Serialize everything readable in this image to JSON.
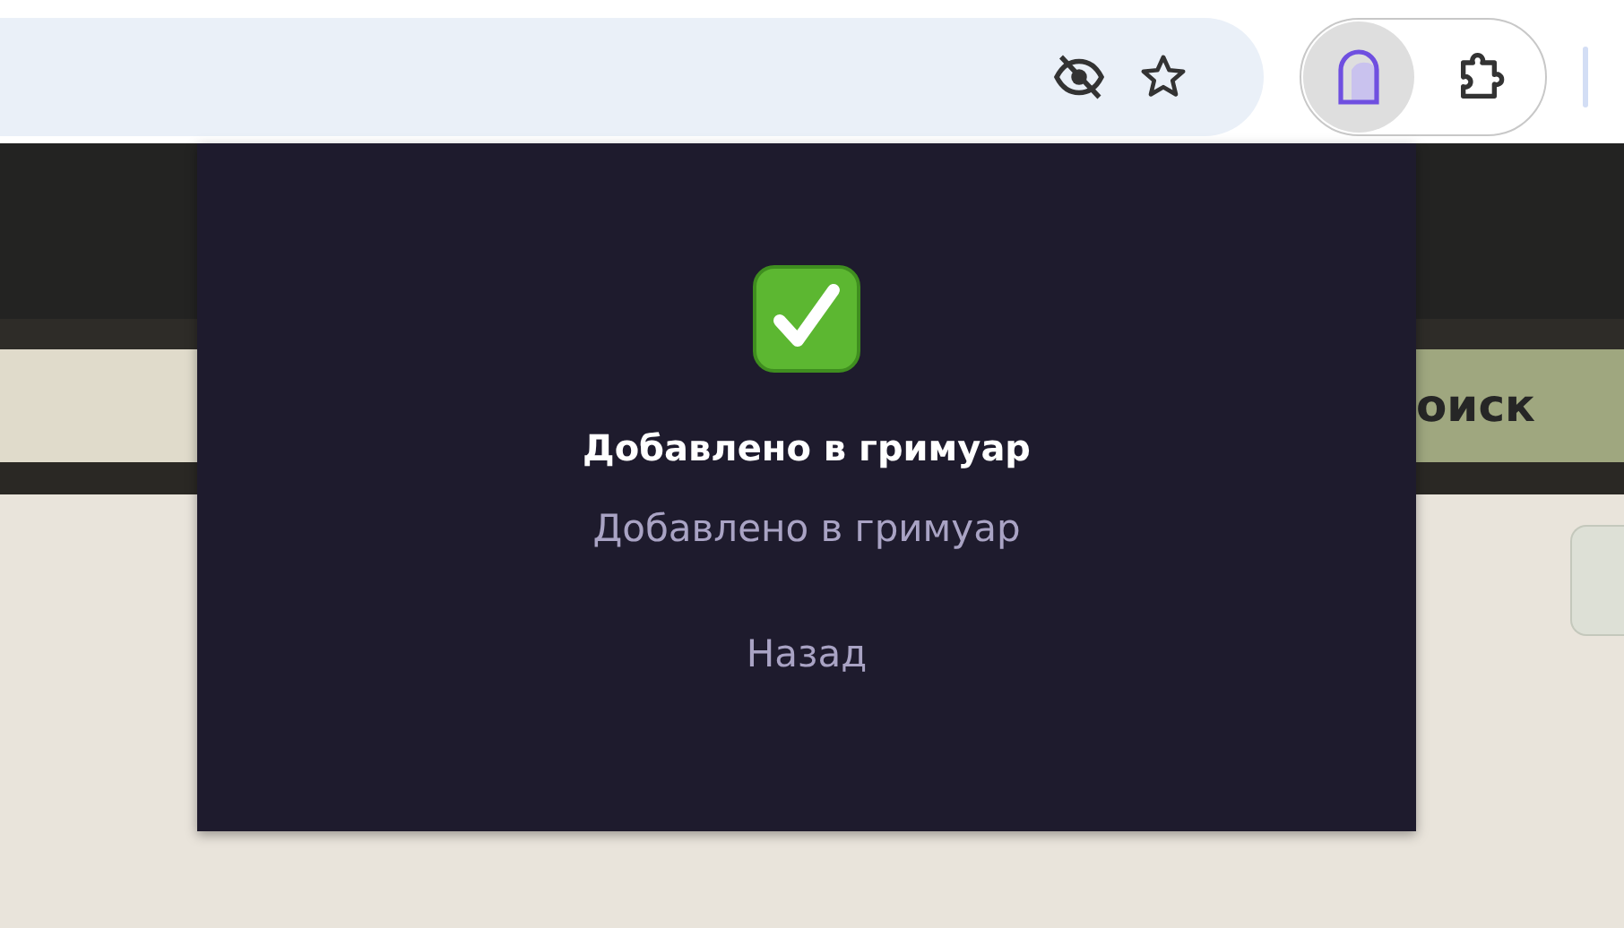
{
  "toolbar": {
    "extensions": [
      {
        "kind": "arch",
        "selected": true
      },
      {
        "kind": "puzzle",
        "selected": false
      }
    ]
  },
  "page": {
    "search_button": "оиск"
  },
  "popup": {
    "title": "Добавлено в гримуар",
    "message": "Добавлено в гримуар",
    "back_link": "Назад"
  }
}
